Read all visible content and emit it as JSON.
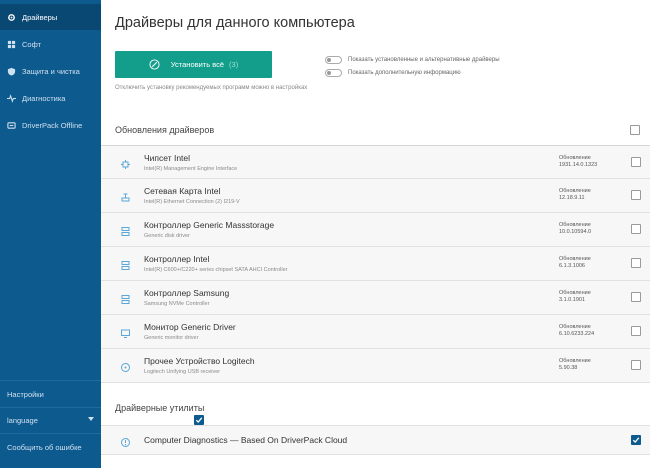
{
  "sidebar": {
    "items": [
      {
        "label": "Драйверы",
        "icon": "gear-icon",
        "active": true
      },
      {
        "label": "Софт",
        "icon": "apps-grid-icon",
        "active": false
      },
      {
        "label": "Защита и чистка",
        "icon": "shield-icon",
        "active": false
      },
      {
        "label": "Диагностика",
        "icon": "pulse-icon",
        "active": false
      },
      {
        "label": "DriverPack Offline",
        "icon": "offline-icon",
        "active": false
      }
    ],
    "settings_label": "Настройки",
    "language_label": "language",
    "report_label": "Сообщить об ошибке"
  },
  "main": {
    "title": "Драйверы для данного компьютера",
    "install_button": {
      "label": "Установить всё",
      "count": "(3)"
    },
    "hint": "Отключить установку рекомендуемых программ можно в настройках",
    "toggles": [
      {
        "label": "Показать установленные и альтернативные драйверы",
        "on": false
      },
      {
        "label": "Показать дополнительную информацию",
        "on": false
      }
    ],
    "section_updates": {
      "label": "Обновления драйверов",
      "checked": false
    },
    "drivers": [
      {
        "name": "Чипсет Intel",
        "sub": "Intel(R) Management Engine Interface",
        "version_label": "Обновление",
        "version": "1931.14.0.1323",
        "icon": "chip-icon",
        "checked": false
      },
      {
        "name": "Сетевая Карта Intel",
        "sub": "Intel(R) Ethernet Connection (2) I219-V",
        "version_label": "Обновление",
        "version": "12.18.9.11",
        "icon": "network-icon",
        "checked": false
      },
      {
        "name": "Контроллер Generic Massstorage",
        "sub": "Generic disk driver",
        "version_label": "Обновление",
        "version": "10.0.10594.0",
        "icon": "storage-icon",
        "checked": false
      },
      {
        "name": "Контроллер Intel",
        "sub": "Intel(R) C600+/C220+ series chipset SATA AHCI Controller",
        "version_label": "Обновление",
        "version": "6.1.3.1006",
        "icon": "storage-icon",
        "checked": false
      },
      {
        "name": "Контроллер Samsung",
        "sub": "Samsung NVMe Controller",
        "version_label": "Обновление",
        "version": "3.1.0.1901",
        "icon": "storage-icon",
        "checked": false
      },
      {
        "name": "Монитор Generic Driver",
        "sub": "Generic monitor driver",
        "version_label": "Обновление",
        "version": "6.10.6233.224",
        "icon": "monitor-icon",
        "checked": false
      },
      {
        "name": "Прочее Устройство Logitech",
        "sub": "Logitech Unifying USB receiver",
        "version_label": "Обновление",
        "version": "5.90.38",
        "icon": "device-icon",
        "checked": false
      }
    ],
    "section_utils": {
      "label": "Драйверные утилиты",
      "checked": true
    },
    "utils": [
      {
        "name": "Computer Diagnostics — Based On DriverPack Cloud",
        "icon": "diagnostics-icon",
        "checked": true
      }
    ]
  },
  "colors": {
    "sidebar_bg": "#0d5a8f",
    "sidebar_active": "#0a4874",
    "accent_button": "#139e8c",
    "icon_blue": "#5aa7d8"
  }
}
